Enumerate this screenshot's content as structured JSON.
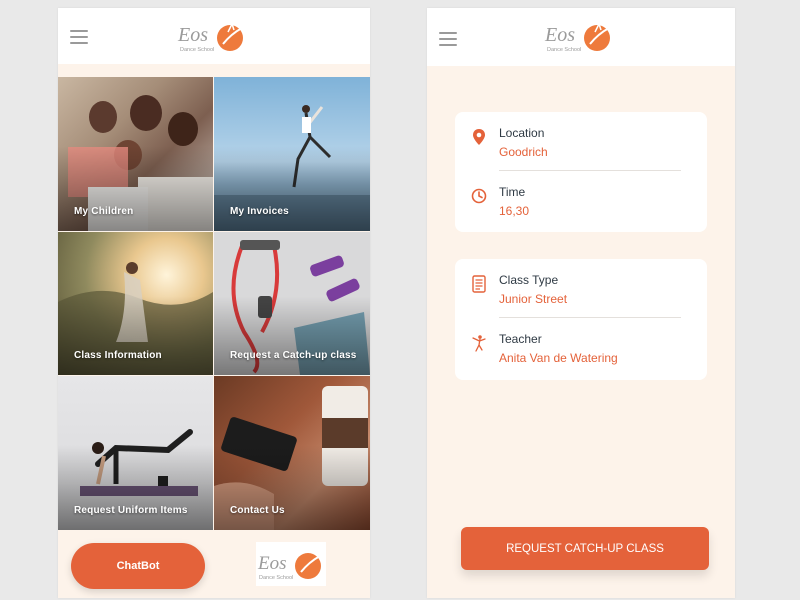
{
  "brand": {
    "logo_text": "Eos",
    "logo_subtext": "Dance School",
    "accent": "#e4623a"
  },
  "left_screen": {
    "tiles": [
      {
        "label": "My Children"
      },
      {
        "label": "My Invoices"
      },
      {
        "label": "Class Information"
      },
      {
        "label": "Request a Catch-up class"
      },
      {
        "label": "Request Uniform Items"
      },
      {
        "label": "Contact Us"
      }
    ],
    "chatbot_label": "ChatBot"
  },
  "right_screen": {
    "location": {
      "title": "Location",
      "value": "Goodrich",
      "icon": "location-pin-icon"
    },
    "time": {
      "title": "Time",
      "value": "16,30",
      "icon": "clock-icon"
    },
    "class_type": {
      "title": "Class Type",
      "value": "Junior Street",
      "icon": "document-list-icon"
    },
    "teacher": {
      "title": "Teacher",
      "value": "Anita Van de Watering",
      "icon": "dancer-icon"
    },
    "button_label": "REQUEST CATCH-UP CLASS"
  }
}
